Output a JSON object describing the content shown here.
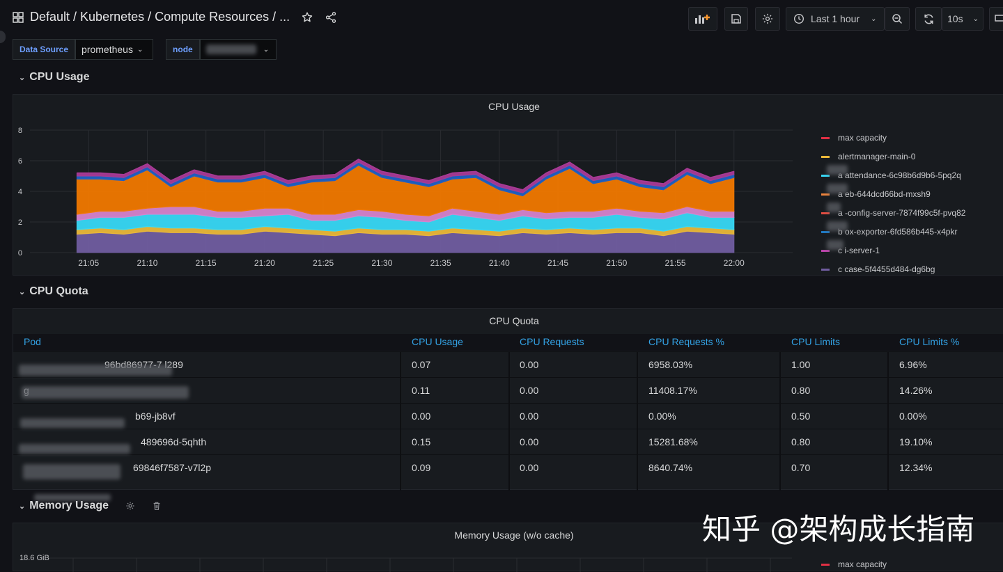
{
  "header": {
    "title": "Default  / Kubernetes / Compute Resources / ...",
    "time_range": "Last 1 hour",
    "refresh_interval": "10s"
  },
  "variables": [
    {
      "label": "Data Source",
      "value": "prometheus"
    },
    {
      "label": "node",
      "value": ""
    }
  ],
  "rows": {
    "cpu_usage": "CPU Usage",
    "cpu_quota": "CPU Quota",
    "memory_usage": "Memory Usage"
  },
  "panels": {
    "cpu_usage_title": "CPU Usage",
    "cpu_quota_title": "CPU Quota",
    "memory_usage_title": "Memory Usage (w/o cache)",
    "memory_y_top": "18.6 GiB",
    "memory_legend_first": "max capacity"
  },
  "cpu_legend": [
    {
      "name": "max capacity",
      "color": "#e02f44"
    },
    {
      "name": "alertmanager-main-0",
      "color": "#eab839"
    },
    {
      "name": "a      attendance-6c98b6d9b6-5pq2q",
      "color": "#37d8f5"
    },
    {
      "name": "a      eb-644dcd66bd-mxsh9",
      "color": "#ef843c"
    },
    {
      "name": "a   -config-server-7874f99c5f-pvq82",
      "color": "#e24d42"
    },
    {
      "name": "b      ox-exporter-6fd586b445-x4pkr",
      "color": "#1f78c1"
    },
    {
      "name": "c    i-server-1",
      "color": "#ba43a9"
    },
    {
      "name": "c     case-5f4455d484-dg6bg",
      "color": "#705da0"
    }
  ],
  "quota_table": {
    "headers": [
      "Pod",
      "CPU Usage",
      "CPU Requests",
      "CPU Requests %",
      "CPU Limits",
      "CPU Limits %"
    ],
    "rows": [
      {
        "pod": "96bd86977-7 l289",
        "usage": "0.07",
        "requests": "0.00",
        "requests_pct": "6958.03%",
        "limits": "1.00",
        "limits_pct": "6.96%"
      },
      {
        "pod": "g",
        "usage": "0.11",
        "requests": "0.00",
        "requests_pct": "11408.17%",
        "limits": "0.80",
        "limits_pct": "14.26%"
      },
      {
        "pod": "b69-jb8vf",
        "usage": "0.00",
        "requests": "0.00",
        "requests_pct": "0.00%",
        "limits": "0.50",
        "limits_pct": "0.00%"
      },
      {
        "pod": "489696d-5qhth",
        "usage": "0.15",
        "requests": "0.00",
        "requests_pct": "15281.68%",
        "limits": "0.80",
        "limits_pct": "19.10%"
      },
      {
        "pod": "69846f7587-v7l2p",
        "usage": "0.09",
        "requests": "0.00",
        "requests_pct": "8640.74%",
        "limits": "0.70",
        "limits_pct": "12.34%"
      }
    ]
  },
  "watermark": "知乎 @架构成长指南",
  "chart_data": {
    "type": "area",
    "title": "CPU Usage",
    "x": [
      "21:04",
      "21:06",
      "21:08",
      "21:10",
      "21:12",
      "21:14",
      "21:16",
      "21:18",
      "21:20",
      "21:22",
      "21:24",
      "21:26",
      "21:28",
      "21:30",
      "21:32",
      "21:34",
      "21:36",
      "21:38",
      "21:40",
      "21:42",
      "21:44",
      "21:46",
      "21:48",
      "21:50",
      "21:52",
      "21:54",
      "21:56",
      "21:58",
      "22:00"
    ],
    "x_ticks": [
      "21:05",
      "21:10",
      "21:15",
      "21:20",
      "21:25",
      "21:30",
      "21:35",
      "21:40",
      "21:45",
      "21:50",
      "21:55",
      "22:00"
    ],
    "y_ticks": [
      "0",
      "2",
      "4",
      "6",
      "8"
    ],
    "ylim": [
      0,
      8
    ],
    "series": [
      {
        "name": "c     case-5f4455d484-dg6bg",
        "color": "#705da0",
        "values": [
          1.2,
          1.3,
          1.2,
          1.4,
          1.3,
          1.3,
          1.2,
          1.2,
          1.4,
          1.3,
          1.2,
          1.1,
          1.3,
          1.2,
          1.2,
          1.1,
          1.3,
          1.2,
          1.1,
          1.3,
          1.2,
          1.3,
          1.2,
          1.3,
          1.3,
          1.1,
          1.4,
          1.3,
          1.2
        ]
      },
      {
        "name": "alertmanager-main-0",
        "color": "#eab839",
        "values": [
          0.3,
          0.3,
          0.3,
          0.3,
          0.3,
          0.3,
          0.3,
          0.3,
          0.3,
          0.3,
          0.3,
          0.3,
          0.3,
          0.3,
          0.3,
          0.3,
          0.3,
          0.3,
          0.3,
          0.3,
          0.3,
          0.3,
          0.3,
          0.3,
          0.3,
          0.3,
          0.3,
          0.3,
          0.3
        ]
      },
      {
        "name": "a      attendance-6c98b6d9b6-5pq2q",
        "color": "#37d8f5",
        "values": [
          0.6,
          0.7,
          0.8,
          0.8,
          0.9,
          0.9,
          0.8,
          0.8,
          0.7,
          0.9,
          0.6,
          0.7,
          0.8,
          0.8,
          0.6,
          0.6,
          0.9,
          0.8,
          0.7,
          0.8,
          0.7,
          0.7,
          0.8,
          0.9,
          0.7,
          0.8,
          0.9,
          0.7,
          0.8
        ]
      },
      {
        "name": "a   -config-server-7874f99c5f-pvq82",
        "color": "#d683ce",
        "values": [
          0.4,
          0.4,
          0.4,
          0.4,
          0.5,
          0.5,
          0.4,
          0.4,
          0.5,
          0.4,
          0.4,
          0.4,
          0.4,
          0.4,
          0.4,
          0.4,
          0.4,
          0.4,
          0.4,
          0.4,
          0.4,
          0.4,
          0.4,
          0.4,
          0.4,
          0.4,
          0.4,
          0.4,
          0.4
        ]
      },
      {
        "name": "a      eb-644dcd66bd-mxsh9",
        "color": "#f07800",
        "values": [
          2.3,
          2.1,
          2.0,
          2.5,
          1.3,
          2.0,
          1.9,
          1.9,
          2.0,
          1.4,
          2.1,
          2.2,
          2.9,
          2.2,
          2.1,
          1.9,
          1.9,
          2.2,
          1.6,
          0.9,
          2.2,
          2.8,
          1.8,
          1.9,
          1.6,
          1.5,
          2.1,
          1.8,
          2.2
        ]
      },
      {
        "name": "b      ox-exporter-6fd586b445-x4pkr",
        "color": "#1f60c4",
        "values": [
          0.2,
          0.2,
          0.2,
          0.2,
          0.2,
          0.2,
          0.2,
          0.2,
          0.2,
          0.2,
          0.2,
          0.2,
          0.2,
          0.2,
          0.2,
          0.2,
          0.2,
          0.2,
          0.2,
          0.2,
          0.2,
          0.2,
          0.2,
          0.2,
          0.2,
          0.2,
          0.2,
          0.2,
          0.2
        ]
      },
      {
        "name": "c    i-server-1",
        "color": "#a83a96",
        "values": [
          0.2,
          0.2,
          0.2,
          0.2,
          0.2,
          0.2,
          0.2,
          0.2,
          0.2,
          0.2,
          0.2,
          0.2,
          0.2,
          0.2,
          0.2,
          0.2,
          0.2,
          0.2,
          0.2,
          0.2,
          0.2,
          0.2,
          0.2,
          0.2,
          0.2,
          0.2,
          0.2,
          0.2,
          0.2
        ]
      }
    ]
  }
}
